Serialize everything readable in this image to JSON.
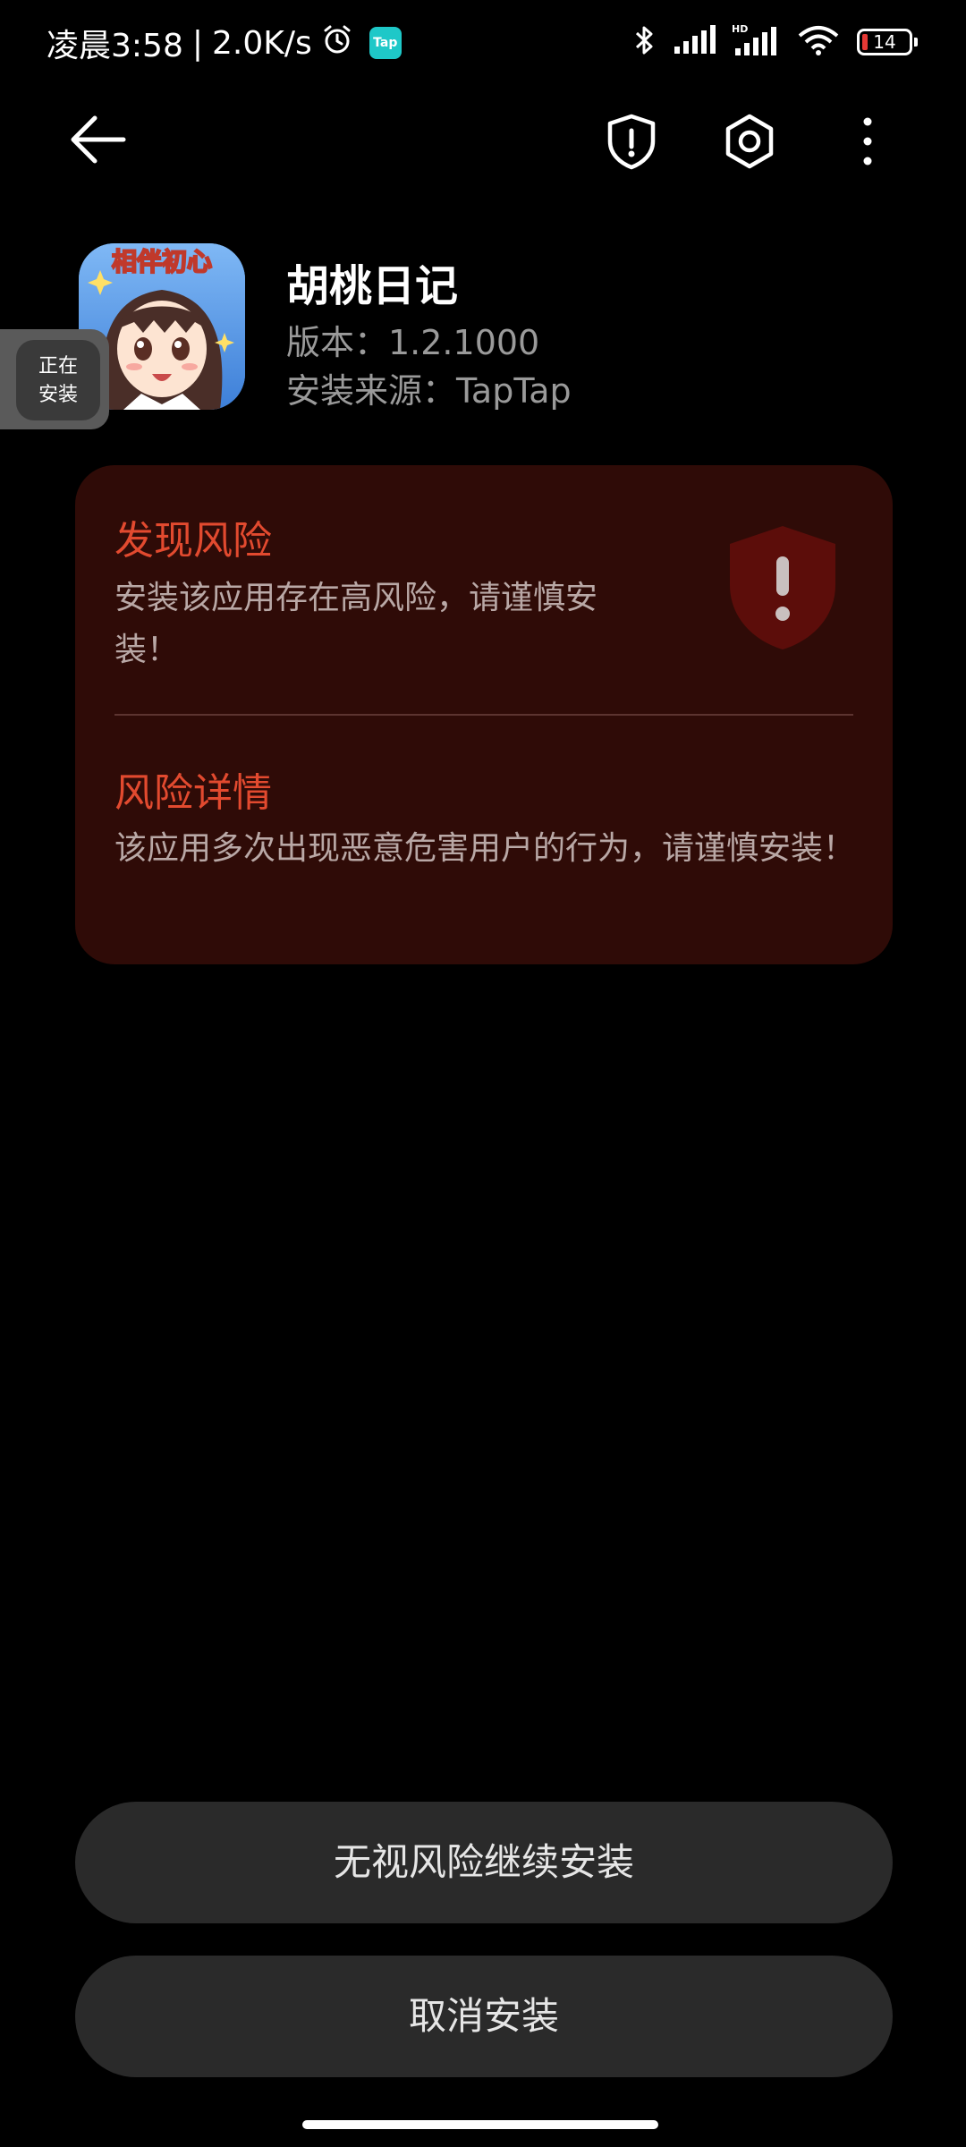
{
  "status_bar": {
    "time": "凌晨3:58",
    "separator": "|",
    "net_speed": "2.0K/s",
    "tap_badge": "Tap",
    "battery_level": "14",
    "icons": [
      "alarm-icon",
      "tap-icon",
      "bluetooth-icon",
      "signal-icon",
      "hd-signal-icon",
      "wifi-icon",
      "battery-icon"
    ]
  },
  "top_bar": {
    "icons": [
      "back-arrow-icon",
      "shield-alert-icon",
      "settings-icon",
      "more-vertical-icon"
    ]
  },
  "app": {
    "name": "胡桃日记",
    "version": "版本：1.2.1000",
    "source": "安装来源：TapTap",
    "icon_text": "相伴初心"
  },
  "install_bubble": {
    "label": "正在\n安装"
  },
  "risk_card": {
    "title": "发现风险",
    "description": "安装该应用存在高风险，请谨慎安装！",
    "detail_title": "风险详情",
    "detail_description": "该应用多次出现恶意危害用户的行为，请谨慎安装！"
  },
  "buttons": {
    "continue_label": "无视风险继续安装",
    "cancel_label": "取消安装"
  },
  "colors": {
    "background": "#000000",
    "risk_card_bg": "#2f0b07",
    "risk_accent": "#e24a2f",
    "button_bg": "#2a2a2a",
    "tap_accent": "#1ec8c8"
  }
}
